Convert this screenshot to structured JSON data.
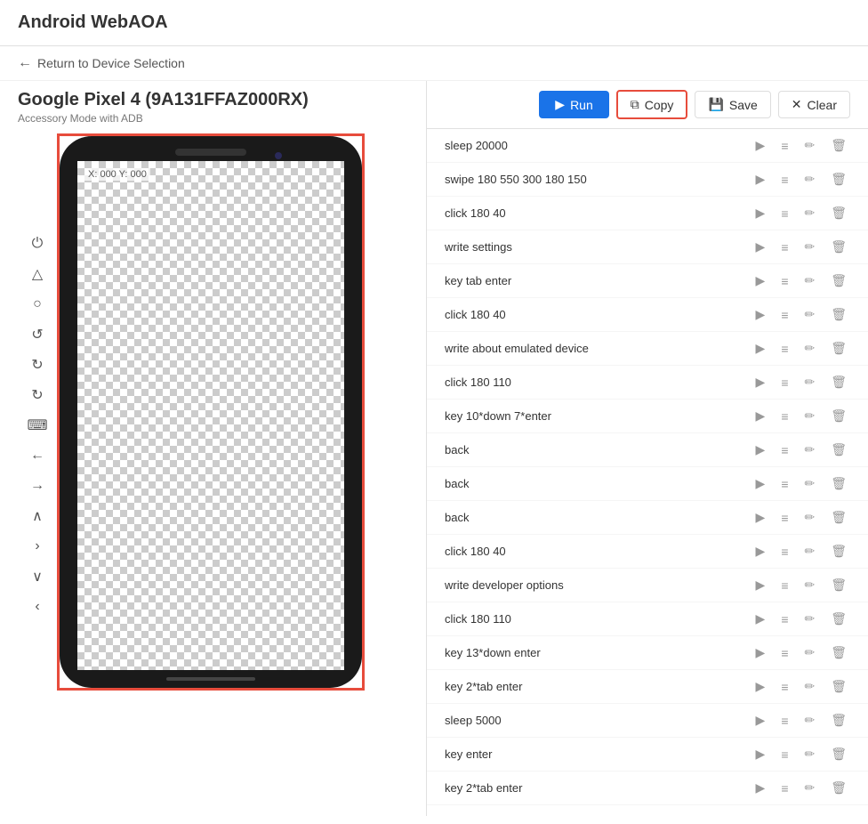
{
  "app": {
    "title": "Android WebAOA"
  },
  "nav": {
    "back_label": "Return to Device Selection"
  },
  "device": {
    "name": "Google Pixel 4 (9A131FFAZ000RX)",
    "subtitle": "Accessory Mode with ADB",
    "coords": "X: 000 Y: 000"
  },
  "toolbar": {
    "run_label": "Run",
    "copy_label": "Copy",
    "save_label": "Save",
    "clear_label": "Clear"
  },
  "commands": [
    {
      "id": 1,
      "text": "sleep 20000"
    },
    {
      "id": 2,
      "text": "swipe 180 550 300 180 150"
    },
    {
      "id": 3,
      "text": "click 180 40"
    },
    {
      "id": 4,
      "text": "write settings"
    },
    {
      "id": 5,
      "text": "key tab enter"
    },
    {
      "id": 6,
      "text": "click 180 40"
    },
    {
      "id": 7,
      "text": "write about emulated device"
    },
    {
      "id": 8,
      "text": "click 180 110"
    },
    {
      "id": 9,
      "text": "key 10*down 7*enter"
    },
    {
      "id": 10,
      "text": "back"
    },
    {
      "id": 11,
      "text": "back"
    },
    {
      "id": 12,
      "text": "back"
    },
    {
      "id": 13,
      "text": "click 180 40"
    },
    {
      "id": 14,
      "text": "write developer options"
    },
    {
      "id": 15,
      "text": "click 180 110"
    },
    {
      "id": 16,
      "text": "key 13*down enter"
    },
    {
      "id": 17,
      "text": "key 2*tab enter"
    },
    {
      "id": 18,
      "text": "sleep 5000"
    },
    {
      "id": 19,
      "text": "key enter"
    },
    {
      "id": 20,
      "text": "key 2*tab enter"
    }
  ],
  "side_controls": [
    {
      "id": "power",
      "icon": "⏻",
      "label": "power-button"
    },
    {
      "id": "home",
      "icon": "△",
      "label": "home-button"
    },
    {
      "id": "back-circle",
      "icon": "○",
      "label": "back-circle-button"
    },
    {
      "id": "rotate-ccw",
      "icon": "↺",
      "label": "rotate-ccw-button"
    },
    {
      "id": "rotate-cw",
      "icon": "↻",
      "label": "rotate-cw-button"
    },
    {
      "id": "rotate-cw2",
      "icon": "↻",
      "label": "rotate-cw2-button"
    },
    {
      "id": "keyboard",
      "icon": "⌨",
      "label": "keyboard-button"
    },
    {
      "id": "nav-left",
      "icon": "←",
      "label": "nav-left-button"
    },
    {
      "id": "nav-right",
      "icon": "→",
      "label": "nav-right-button"
    },
    {
      "id": "chevron-up",
      "icon": "∧",
      "label": "chevron-up-button"
    },
    {
      "id": "chevron-right",
      "icon": "›",
      "label": "chevron-right-button"
    },
    {
      "id": "chevron-down",
      "icon": "∨",
      "label": "chevron-down-button"
    },
    {
      "id": "chevron-left",
      "icon": "‹",
      "label": "chevron-left-button"
    }
  ]
}
